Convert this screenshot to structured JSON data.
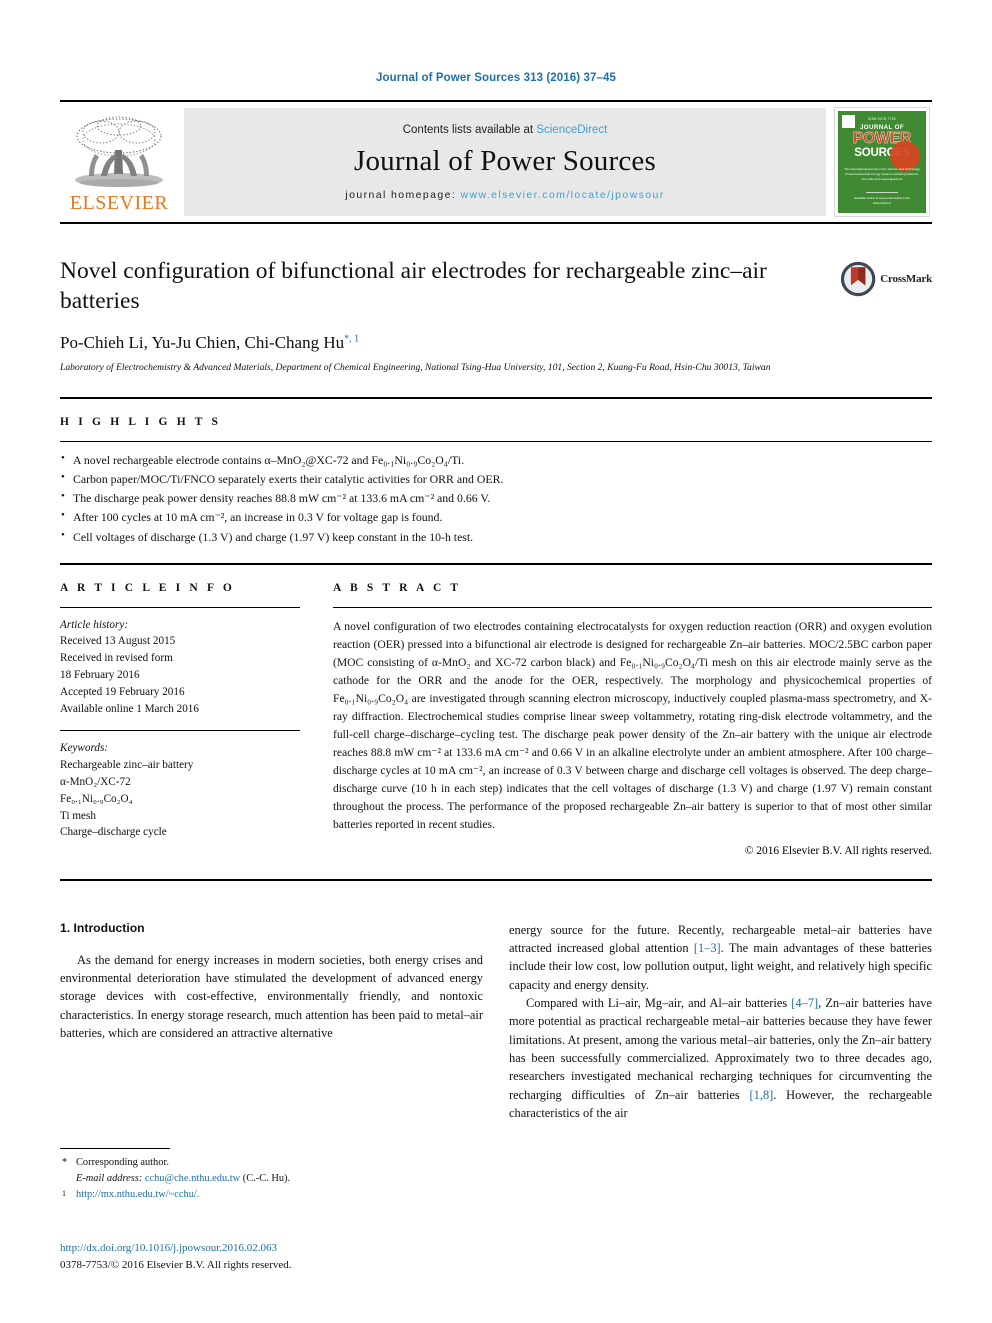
{
  "running_head": "Journal of Power Sources 313 (2016) 37–45",
  "masthead": {
    "publisher": "ELSEVIER",
    "contents_prefix": "Contents lists available at ",
    "contents_link": "ScienceDirect",
    "journal_name": "Journal of Power Sources",
    "homepage_prefix": "journal homepage: ",
    "homepage_url": "www.elsevier.com/locate/jpowsour",
    "cover": {
      "top_text": "ISSN 0378-7753",
      "line1": "JOURNAL OF",
      "line2": "POWER",
      "line3": "SOURCES",
      "subtitle": "The international journal on the science and technology of electrochemical energy systems including batteries, fuel cells and supercapacitors",
      "bottom": "Available online at www.sciencedirect.com",
      "bottom2": "ScienceDirect"
    }
  },
  "article": {
    "title": "Novel configuration of bifunctional air electrodes for rechargeable zinc–air batteries",
    "authors": "Po-Chieh Li, Yu-Ju Chien, Chi-Chang Hu",
    "author_marks": "*, 1",
    "affiliation": "Laboratory of Electrochemistry & Advanced Materials, Department of Chemical Engineering, National Tsing-Hua University, 101, Section 2, Kuang-Fu Road, Hsin-Chu 30013, Taiwan",
    "crossmark_label": "CrossMark"
  },
  "highlights": {
    "heading": "H I G H L I G H T S",
    "items": [
      "A novel rechargeable electrode contains α–MnO₂@XC-72 and Fe₀.₁Ni₀.₉Co₂O₄/Ti.",
      "Carbon paper/MOC/Ti/FNCO separately exerts their catalytic activities for ORR and OER.",
      "The discharge peak power density reaches 88.8 mW cm⁻² at 133.6 mA cm⁻² and 0.66 V.",
      "After 100 cycles at 10 mA cm⁻², an increase in 0.3 V for voltage gap is found.",
      "Cell voltages of discharge (1.3 V) and charge (1.97 V) keep constant in the 10-h test."
    ]
  },
  "article_info": {
    "heading": "A R T I C L E  I N F O",
    "history_label": "Article history:",
    "history": [
      "Received 13 August 2015",
      "Received in revised form",
      "18 February 2016",
      "Accepted 19 February 2016",
      "Available online 1 March 2016"
    ],
    "keywords_label": "Keywords:",
    "keywords": [
      "Rechargeable zinc–air battery",
      "α-MnO₂/XC-72",
      "Fe₀.₁Ni₀.₉Co₂O₄",
      "Ti mesh",
      "Charge–discharge cycle"
    ]
  },
  "abstract": {
    "heading": "A B S T R A C T",
    "text": "A novel configuration of two electrodes containing electrocatalysts for oxygen reduction reaction (ORR) and oxygen evolution reaction (OER) pressed into a bifunctional air electrode is designed for rechargeable Zn–air batteries. MOC/2.5BC carbon paper (MOC consisting of α-MnO₂ and XC-72 carbon black) and Fe₀.₁Ni₀.₉Co₂O₄/Ti mesh on this air electrode mainly serve as the cathode for the ORR and the anode for the OER, respectively. The morphology and physicochemical properties of Fe₀.₁Ni₀.₉Co₂O₄ are investigated through scanning electron microscopy, inductively coupled plasma-mass spectrometry, and X-ray diffraction. Electrochemical studies comprise linear sweep voltammetry, rotating ring-disk electrode voltammetry, and the full-cell charge–discharge–cycling test. The discharge peak power density of the Zn–air battery with the unique air electrode reaches 88.8 mW cm⁻² at 133.6 mA cm⁻² and 0.66 V in an alkaline electrolyte under an ambient atmosphere. After 100 charge–discharge cycles at 10 mA cm⁻², an increase of 0.3 V between charge and discharge cell voltages is observed. The deep charge–discharge curve (10 h in each step) indicates that the cell voltages of discharge (1.3 V) and charge (1.97 V) remain constant throughout the process. The performance of the proposed rechargeable Zn–air battery is superior to that of most other similar batteries reported in recent studies.",
    "copyright": "© 2016 Elsevier B.V. All rights reserved."
  },
  "introduction": {
    "number_title": "1.  Introduction",
    "left_para1": "As the demand for energy increases in modern societies, both energy crises and environmental deterioration have stimulated the development of advanced energy storage devices with cost-effective, environmentally friendly, and nontoxic characteristics. In energy storage research, much attention has been paid to metal–air batteries, which are considered an attractive alternative",
    "right_para1_a": "energy source for the future. Recently, rechargeable metal–air batteries have attracted increased global attention ",
    "right_para1_ref": "[1–3]",
    "right_para1_b": ". The main advantages of these batteries include their low cost, low pollution output, light weight, and relatively high specific capacity and energy density.",
    "right_para2_a": "Compared with Li–air, Mg–air, and Al–air batteries ",
    "right_para2_ref1": "[4–7]",
    "right_para2_b": ", Zn–air batteries have more potential as practical rechargeable metal–air batteries because they have fewer limitations. At present, among the various metal–air batteries, only the Zn–air battery has been successfully commercialized. Approximately two to three decades ago, researchers investigated mechanical recharging techniques for circumventing the recharging difficulties of Zn–air batteries ",
    "right_para2_ref2": "[1,8]",
    "right_para2_c": ". However, the rechargeable characteristics of the air"
  },
  "footnotes": {
    "corresponding": "Corresponding author.",
    "email_label": "E-mail address:",
    "email": "cchu@che.nthu.edu.tw",
    "email_owner": "(C.-C. Hu).",
    "url": "http://mx.nthu.edu.tw/~cchu/."
  },
  "footer": {
    "doi": "http://dx.doi.org/10.1016/j.jpowsour.2016.02.063",
    "issn_line": "0378-7753/© 2016 Elsevier B.V. All rights reserved."
  },
  "colors": {
    "link_blue": "#1f6fa8",
    "sciencedirect_blue": "#3f9fd4",
    "elsevier_orange": "#e87722",
    "cover_green": "#3f8a33",
    "crossmark_red": "#c0392b"
  }
}
